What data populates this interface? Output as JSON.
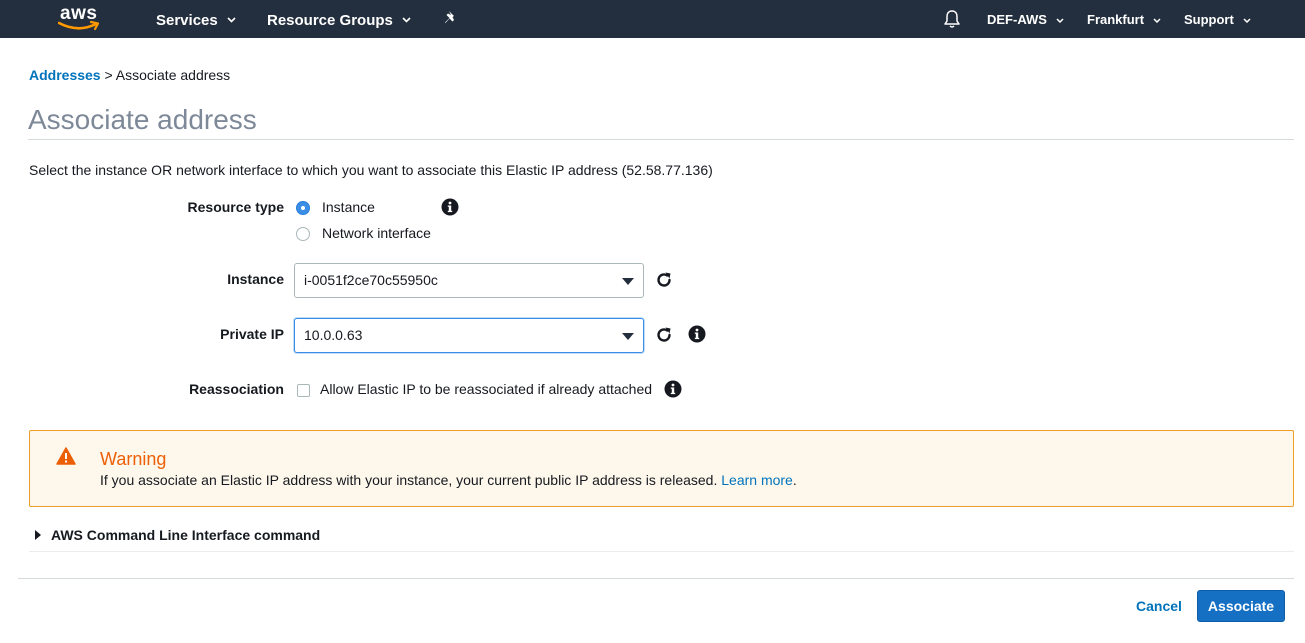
{
  "nav": {
    "logo": "aws",
    "services": "Services",
    "resource_groups": "Resource Groups",
    "account": "DEF-AWS",
    "region": "Frankfurt",
    "support": "Support"
  },
  "breadcrumb": {
    "parent": "Addresses",
    "separator": " > ",
    "current": "Associate address"
  },
  "page": {
    "title": "Associate address",
    "intro": "Select the instance OR network interface to which you want to associate this Elastic IP address (52.58.77.136)"
  },
  "form": {
    "resource_type_label": "Resource type",
    "resource_type_options": [
      "Instance",
      "Network interface"
    ],
    "resource_type_selected": "Instance",
    "instance_label": "Instance",
    "instance_value": "i-0051f2ce70c55950c",
    "private_ip_label": "Private IP",
    "private_ip_value": "10.0.0.63",
    "reassociation_label": "Reassociation",
    "reassociation_text": "Allow Elastic IP to be reassociated if already attached",
    "reassociation_checked": false
  },
  "warning": {
    "title": "Warning",
    "text": "If you associate an Elastic IP address with your instance, your current public IP address is released.",
    "link": "Learn more",
    "suffix": "."
  },
  "cli": {
    "label": "AWS Command Line Interface command"
  },
  "footer": {
    "cancel": "Cancel",
    "associate": "Associate"
  },
  "colors": {
    "nav_bg": "#232f3e",
    "link": "#0073bb",
    "primary_button": "#1570c4",
    "warning_border": "#ec9e28",
    "warning_bg": "#fef8ec",
    "warning_title": "#eb5f07"
  },
  "icons": [
    "aws-logo",
    "chevron-down-icon",
    "pin-icon",
    "bell-icon",
    "info-icon",
    "refresh-icon",
    "warning-icon",
    "caret-right-icon"
  ]
}
